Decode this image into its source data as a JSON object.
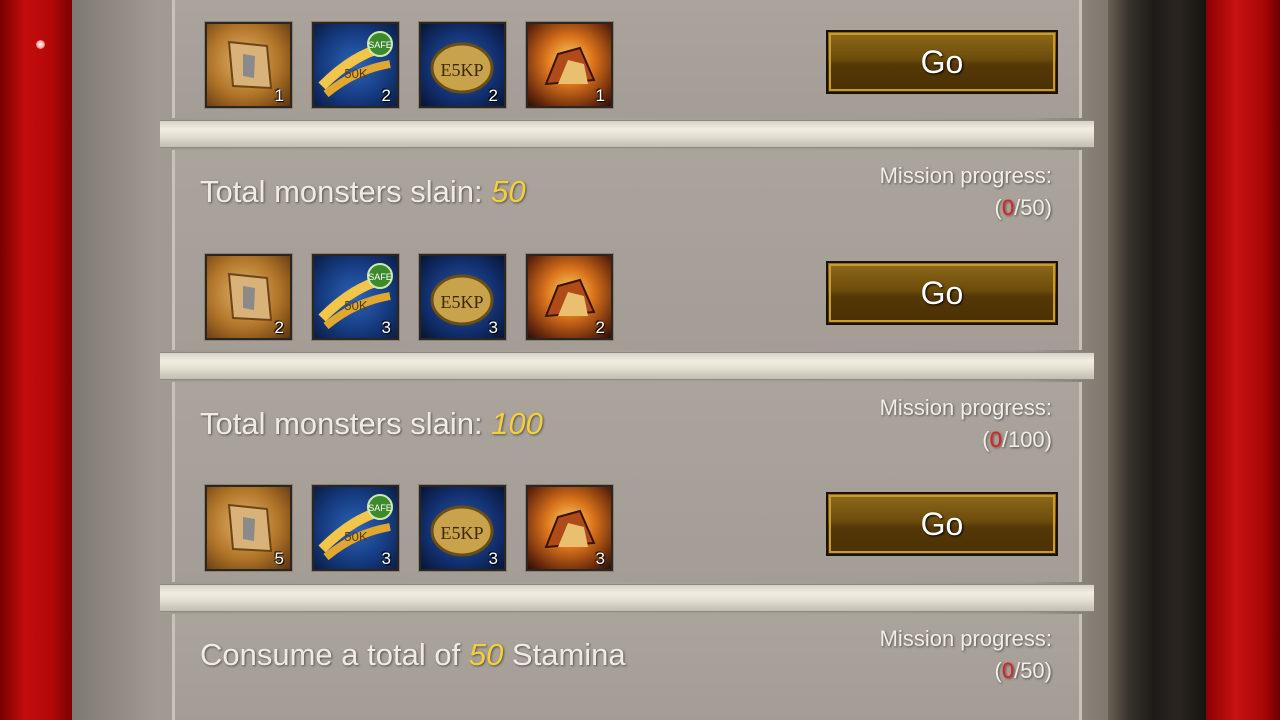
{
  "missions": [
    {
      "go_label": "Go",
      "rewards": [
        {
          "type": "scroll",
          "count": "1"
        },
        {
          "type": "wheat",
          "count": "2"
        },
        {
          "type": "exp",
          "count": "2"
        },
        {
          "type": "chest",
          "count": "1"
        }
      ]
    },
    {
      "title_prefix": "Total monsters slain: ",
      "title_value": "50",
      "progress_label": "Mission progress:",
      "progress_open": "(",
      "progress_current": "0",
      "progress_rest": "/50)",
      "go_label": "Go",
      "rewards": [
        {
          "type": "scroll",
          "count": "2"
        },
        {
          "type": "wheat",
          "count": "3"
        },
        {
          "type": "exp",
          "count": "3"
        },
        {
          "type": "chest",
          "count": "2"
        }
      ]
    },
    {
      "title_prefix": "Total monsters slain: ",
      "title_value": "100",
      "progress_label": "Mission progress:",
      "progress_open": "(",
      "progress_current": "0",
      "progress_rest": "/100)",
      "go_label": "Go",
      "rewards": [
        {
          "type": "scroll",
          "count": "5"
        },
        {
          "type": "wheat",
          "count": "3"
        },
        {
          "type": "exp",
          "count": "3"
        },
        {
          "type": "chest",
          "count": "3"
        }
      ]
    },
    {
      "title_prefix": "Consume a total of ",
      "title_value": "50",
      "title_suffix": " Stamina",
      "progress_label": "Mission progress:",
      "progress_open": "(",
      "progress_current": "0",
      "progress_rest": "/50)"
    }
  ],
  "item_art": {
    "wheat_value": "50K",
    "wheat_badge": "SAFE",
    "exp_value": "E5KP"
  },
  "colors": {
    "accent_value": "#f5cf3a",
    "progress_current": "#e02020",
    "button_gold": "#c79b2e"
  }
}
